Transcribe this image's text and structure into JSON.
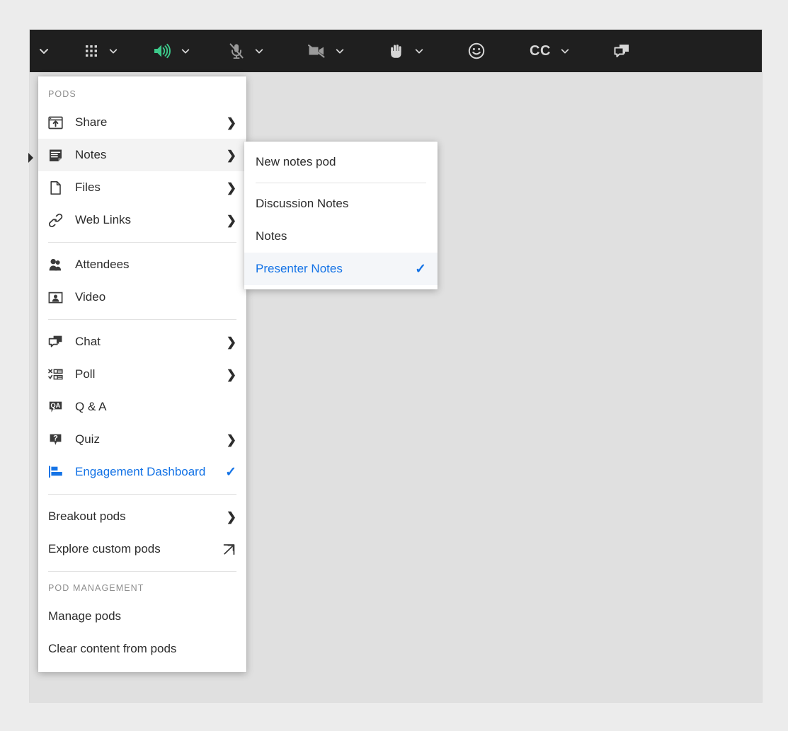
{
  "window": {
    "background_color": "#e0e0e0",
    "page_background_color": "#ececec"
  },
  "toolbar": {
    "background_color": "#1f1f1f",
    "active_color": "#3cc98a",
    "icon_color": "#d6d6d6",
    "items": [
      {
        "name": "leading-caret",
        "icon": "chevron-down-icon",
        "label": "",
        "has_caret": false,
        "state": ""
      },
      {
        "name": "apps-grid",
        "icon": "grid-apps-icon",
        "label": "",
        "has_caret": true,
        "state": "default"
      },
      {
        "name": "speaker",
        "icon": "speaker-on-icon",
        "label": "",
        "has_caret": true,
        "state": "active"
      },
      {
        "name": "microphone",
        "icon": "microphone-muted-icon",
        "label": "",
        "has_caret": true,
        "state": "muted"
      },
      {
        "name": "camera",
        "icon": "camera-off-icon",
        "label": "",
        "has_caret": true,
        "state": "off"
      },
      {
        "name": "raise-hand",
        "icon": "raise-hand-icon",
        "label": "",
        "has_caret": true,
        "state": "default"
      },
      {
        "name": "reactions",
        "icon": "smiley-face-icon",
        "label": "",
        "has_caret": false,
        "state": "default"
      },
      {
        "name": "closed-captions",
        "icon": "cc-text-icon",
        "label": "CC",
        "has_caret": true,
        "state": "default"
      },
      {
        "name": "chat",
        "icon": "chat-bubbles-icon",
        "label": "",
        "has_caret": false,
        "state": "default"
      }
    ]
  },
  "pods_menu": {
    "section_label": "PODS",
    "management_label": "POD MANAGEMENT",
    "accent_color": "#1473e6",
    "items": [
      {
        "label": "Share",
        "icon": "share-window-icon",
        "chevron": true,
        "check": false,
        "hovered": false,
        "selected": false
      },
      {
        "label": "Notes",
        "icon": "notes-icon",
        "chevron": true,
        "check": false,
        "hovered": true,
        "selected": false
      },
      {
        "label": "Files",
        "icon": "file-page-icon",
        "chevron": true,
        "check": false,
        "hovered": false,
        "selected": false
      },
      {
        "label": "Web Links",
        "icon": "link-chain-icon",
        "chevron": true,
        "check": false,
        "hovered": false,
        "selected": false
      },
      {
        "label": "Attendees",
        "icon": "attendees-people-icon",
        "chevron": false,
        "check": false,
        "hovered": false,
        "selected": false
      },
      {
        "label": "Video",
        "icon": "video-person-icon",
        "chevron": false,
        "check": false,
        "hovered": false,
        "selected": false
      },
      {
        "label": "Chat",
        "icon": "chat-bubbles-icon",
        "chevron": true,
        "check": false,
        "hovered": false,
        "selected": false
      },
      {
        "label": "Poll",
        "icon": "poll-bars-icon",
        "chevron": true,
        "check": false,
        "hovered": false,
        "selected": false
      },
      {
        "label": "Q & A",
        "icon": "qa-bubble-icon",
        "chevron": false,
        "check": false,
        "hovered": false,
        "selected": false
      },
      {
        "label": "Quiz",
        "icon": "quiz-bubble-icon",
        "chevron": true,
        "check": false,
        "hovered": false,
        "selected": false
      },
      {
        "label": "Engagement Dashboard",
        "icon": "bar-chart-icon",
        "chevron": false,
        "check": true,
        "hovered": false,
        "selected": true
      },
      {
        "label": "Breakout pods",
        "icon": "",
        "chevron": true,
        "check": false,
        "hovered": false,
        "selected": false
      },
      {
        "label": "Explore custom pods",
        "icon": "",
        "chevron": false,
        "check": false,
        "hovered": false,
        "selected": false,
        "external": true
      },
      {
        "label": "Manage pods",
        "icon": "",
        "chevron": false,
        "check": false,
        "hovered": false,
        "selected": false
      },
      {
        "label": "Clear content from pods",
        "icon": "",
        "chevron": false,
        "check": false,
        "hovered": false,
        "selected": false
      }
    ]
  },
  "notes_submenu": {
    "new_item": "New notes pod",
    "pods": [
      {
        "label": "Discussion Notes",
        "checked": false
      },
      {
        "label": "Notes",
        "checked": false
      },
      {
        "label": "Presenter Notes",
        "checked": true
      }
    ]
  },
  "glyphs": {
    "chevron_right": "❯",
    "checkmark": "✓"
  }
}
